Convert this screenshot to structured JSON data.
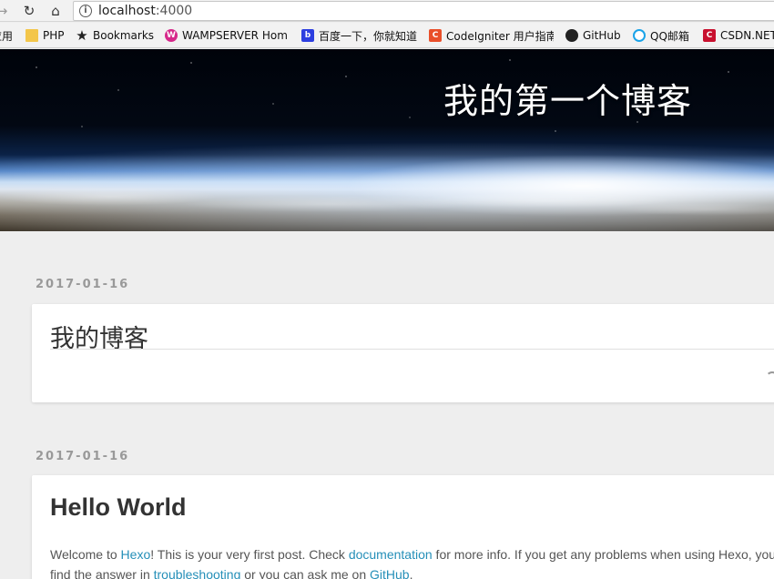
{
  "browser": {
    "url_host": "localhost",
    "url_port": ":4000"
  },
  "bookmarks": [
    {
      "label": "应用",
      "icon": "apps-icon"
    },
    {
      "label": "PHP",
      "icon": "folder-icon"
    },
    {
      "label": "Bookmarks",
      "icon": "star-icon"
    },
    {
      "label": "WAMPSERVER Hom",
      "icon": "wampserver-icon"
    },
    {
      "label": "百度一下，你就知道",
      "icon": "baidu-icon"
    },
    {
      "label": "CodeIgniter 用户指南",
      "icon": "codeigniter-icon"
    },
    {
      "label": "GitHub",
      "icon": "github-icon"
    },
    {
      "label": "QQ邮箱",
      "icon": "qq-mail-icon"
    },
    {
      "label": "CSDN.NET",
      "icon": "csdn-icon"
    }
  ],
  "site": {
    "title": "我的第一个博客"
  },
  "posts": [
    {
      "date": "2017-01-16",
      "title": "我的博客"
    },
    {
      "date": "2017-01-16",
      "title": "Hello World",
      "body": {
        "t1": "Welcome to ",
        "l1": "Hexo",
        "t2": "! This is your very first post. Check ",
        "l2": "documentation",
        "t3": " for more info. If you get any problems when using Hexo, you can",
        "t4": "find the answer in ",
        "l3": "troubleshooting",
        "t5": " or you can ask me on ",
        "l4": "GitHub",
        "t6": "."
      }
    }
  ],
  "colors": {
    "background": "#eeeeee",
    "link": "#258fb8",
    "date": "#999999",
    "title_text": "#333333"
  }
}
